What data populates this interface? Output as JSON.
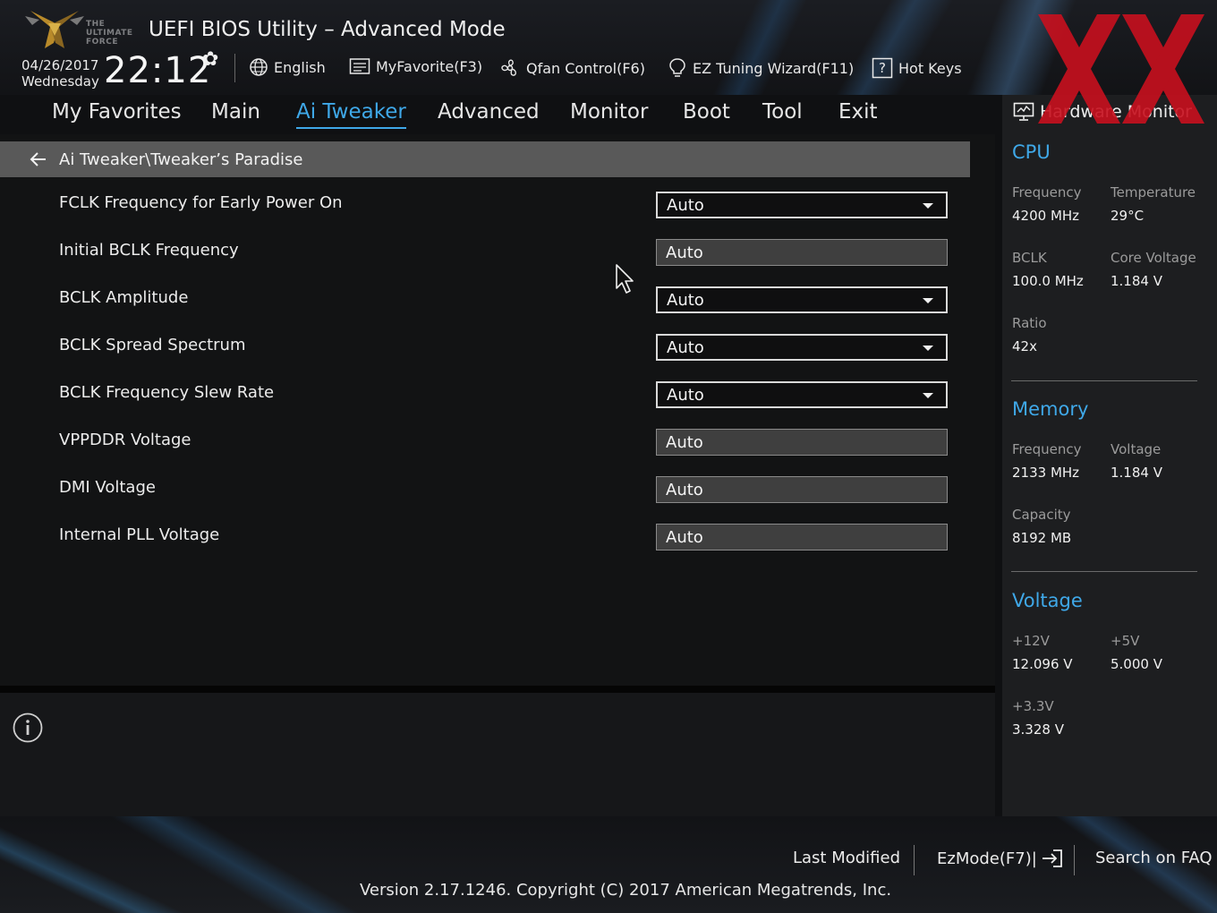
{
  "header": {
    "logo_text": "THE ULTIMATE FORCE",
    "title": "UEFI BIOS Utility – Advanced Mode",
    "date": "04/26/2017",
    "weekday": "Wednesday",
    "time": "22:12",
    "toolbar": {
      "language": "English",
      "myfavorite": "MyFavorite(F3)",
      "qfan": "Qfan Control(F6)",
      "ez_tuning": "EZ Tuning Wizard(F11)",
      "hotkeys": "Hot Keys"
    }
  },
  "nav": {
    "tabs": [
      "My Favorites",
      "Main",
      "Ai Tweaker",
      "Advanced",
      "Monitor",
      "Boot",
      "Tool",
      "Exit"
    ],
    "active": "Ai Tweaker"
  },
  "breadcrumb": "Ai Tweaker\\Tweaker’s Paradise",
  "settings": [
    {
      "label": "FCLK Frequency for Early Power On",
      "value": "Auto",
      "type": "dropdown"
    },
    {
      "label": "Initial BCLK Frequency",
      "value": "Auto",
      "type": "field"
    },
    {
      "label": "BCLK Amplitude",
      "value": "Auto",
      "type": "dropdown"
    },
    {
      "label": "BCLK Spread Spectrum",
      "value": "Auto",
      "type": "dropdown"
    },
    {
      "label": "BCLK Frequency Slew Rate",
      "value": "Auto",
      "type": "dropdown"
    },
    {
      "label": "VPPDDR Voltage",
      "value": "Auto",
      "type": "field"
    },
    {
      "label": "DMI Voltage",
      "value": "Auto",
      "type": "field"
    },
    {
      "label": "Internal PLL Voltage",
      "value": "Auto",
      "type": "field"
    }
  ],
  "hardware_monitor": {
    "title": "Hardware Monitor",
    "cpu": {
      "heading": "CPU",
      "frequency_label": "Frequency",
      "frequency": "4200 MHz",
      "temperature_label": "Temperature",
      "temperature": "29°C",
      "bclk_label": "BCLK",
      "bclk": "100.0 MHz",
      "core_voltage_label": "Core Voltage",
      "core_voltage": "1.184 V",
      "ratio_label": "Ratio",
      "ratio": "42x"
    },
    "memory": {
      "heading": "Memory",
      "frequency_label": "Frequency",
      "frequency": "2133 MHz",
      "voltage_label": "Voltage",
      "voltage": "1.184 V",
      "capacity_label": "Capacity",
      "capacity": "8192 MB"
    },
    "voltage": {
      "heading": "Voltage",
      "v12_label": "+12V",
      "v12": "12.096 V",
      "v5_label": "+5V",
      "v5": "5.000 V",
      "v33_label": "+3.3V",
      "v33": "3.328 V"
    }
  },
  "footer": {
    "last_modified": "Last Modified",
    "ezmode": "EzMode(F7)|",
    "search_faq": "Search on FAQ",
    "version": "Version 2.17.1246. Copyright (C) 2017 American Megatrends, Inc."
  },
  "colors": {
    "accent": "#3fa8e8",
    "watermark": "#c8101e",
    "breadcrumb_bg": "#595959"
  },
  "icons": [
    "gear-icon",
    "globe-icon",
    "myfavorite-icon",
    "fan-icon",
    "bulb-icon",
    "help-icon",
    "back-arrow-icon",
    "monitor-icon",
    "info-icon",
    "exit-icon",
    "mouse-cursor-icon"
  ]
}
